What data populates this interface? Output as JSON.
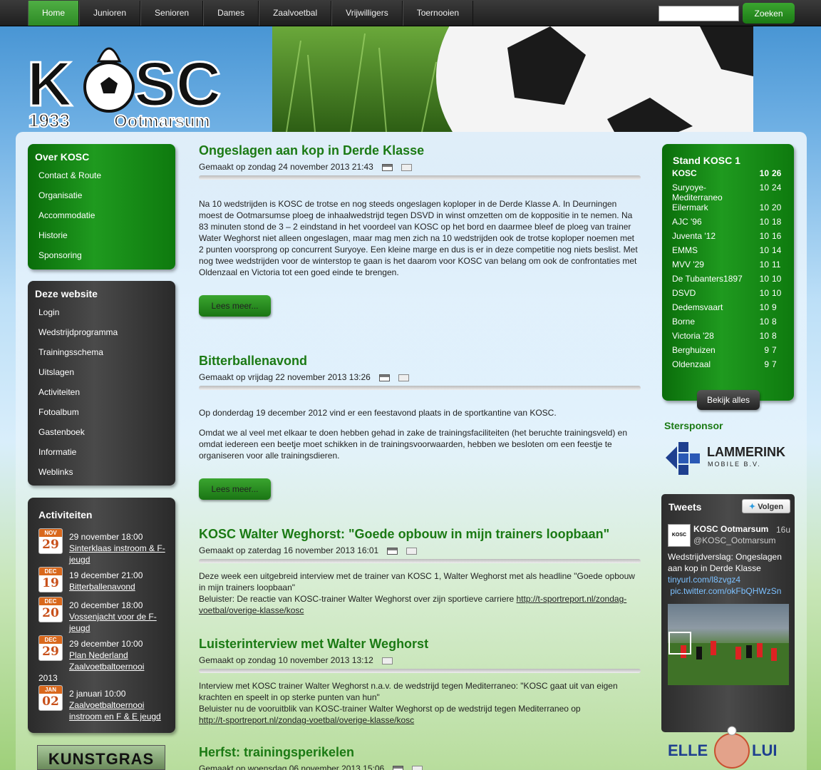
{
  "nav": {
    "items": [
      "Home",
      "Junioren",
      "Senioren",
      "Dames",
      "Zaalvoetbal",
      "Vrijwilligers",
      "Toernooien"
    ],
    "search_button": "Zoeken"
  },
  "logo": {
    "name": "KOSC",
    "year": "1933",
    "town": "Ootmarsum"
  },
  "over": {
    "title": "Over KOSC",
    "items": [
      "Contact & Route",
      "Organisatie",
      "Accommodatie",
      "Historie",
      "Sponsoring"
    ]
  },
  "site": {
    "title": "Deze website",
    "items": [
      "Login",
      "Wedstrijdprogramma",
      "Trainingsschema",
      "Uitslagen",
      "Activiteiten",
      "Fotoalbum",
      "Gastenboek",
      "Informatie",
      "Weblinks"
    ]
  },
  "activiteiten": {
    "title": "Activiteiten",
    "items": [
      {
        "month": "NOV",
        "day": "29",
        "when": "29 november 18:00",
        "what": "Sinterklaas instroom & F-jeugd"
      },
      {
        "month": "DEC",
        "day": "19",
        "when": "19 december 21:00",
        "what": "Bitterballenavond"
      },
      {
        "month": "DEC",
        "day": "20",
        "when": "20 december 18:00",
        "what": "Vossenjacht voor de F-jeugd"
      },
      {
        "month": "DEC",
        "day": "29",
        "when": "29 december 10:00",
        "what": "Plan Nederland Zaalvoetbaltoernooi",
        "extra": "2013"
      },
      {
        "month": "JAN",
        "day": "02",
        "when": "2 januari 10:00",
        "what": "Zaalvoetbaltoernooi instroom en F & E jeugd"
      }
    ]
  },
  "kunstgras": "KUNSTGRAS",
  "articles": [
    {
      "title": "Ongeslagen aan kop in Derde Klasse",
      "meta": "Gemaakt op zondag 24 november 2013 21:43",
      "body": [
        "Na 10 wedstrijden is KOSC de trotse en nog steeds ongeslagen koploper in de Derde Klasse A. In Deurningen moest de Ootmarsumse ploeg de inhaalwedstrijd tegen DSVD in winst omzetten om de koppositie in te nemen. Na 83 minuten stond de 3 – 2 eindstand in het voordeel van KOSC op het bord en daarmee bleef de ploeg van trainer Water Weghorst niet alleen ongeslagen, maar mag men zich na 10 wedstrijden ook de trotse koploper noemen met 2 punten voorsprong op concurrent Suryoye. Een kleine marge en dus is er in deze competitie nog niets beslist. Met nog twee wedstrijden voor de winterstop te gaan is het daarom voor KOSC van belang om ook de confrontaties met Oldenzaal en Victoria tot een goed einde te brengen."
      ],
      "readmore": "Lees meer..."
    },
    {
      "title": "Bitterballenavond",
      "meta": "Gemaakt op vrijdag 22 november 2013 13:26",
      "body": [
        "Op donderdag 19 december 2012 vind er een feestavond plaats in de sportkantine van KOSC.",
        "Omdat we al veel met elkaar te doen hebben gehad in zake de trainingsfaciliteiten (het beruchte trainingsveld) en omdat iedereen een beetje moet schikken in de trainingsvoorwaarden, hebben we besloten om een feestje te organiseren voor alle trainingsdieren."
      ],
      "readmore": "Lees meer..."
    },
    {
      "title": "KOSC Walter Weghorst: \"Goede opbouw in mijn trainers loopbaan\"",
      "meta": "Gemaakt op zaterdag 16 november 2013 16:01",
      "body": [
        "Deze week een uitgebreid interview met de trainer van KOSC 1, Walter Weghorst met als headline  \"Goede opbouw in mijn trainers loopbaan\"",
        "Beluister: De reactie van KOSC-trainer Walter Weghorst over zijn sportieve carriere "
      ],
      "link": "http://t-sportreport.nl/zondag-voetbal/overige-klasse/kosc"
    },
    {
      "title": "Luisterinterview met Walter Weghorst",
      "meta": "Gemaakt op zondag 10 november 2013 13:12",
      "body": [
        "Interview met KOSC trainer Walter Weghorst n.a.v. de wedstrijd tegen Mediterraneo: \"KOSC gaat uit van eigen krachten en speelt in op sterke punten van hun\"",
        "Beluister nu de vooruitblik van KOSC-trainer Walter Weghorst op de wedstrijd tegen Mediterraneo op"
      ],
      "link": "http://t-sportreport.nl/zondag-voetbal/overige-klasse/kosc"
    },
    {
      "title": "Herfst: trainingsperikelen",
      "meta": "Gemaakt op woensdag 06 november 2013 15:06"
    }
  ],
  "stand": {
    "title": "Stand KOSC 1",
    "rows": [
      [
        "KOSC",
        "10",
        "26"
      ],
      [
        "Suryoye-Mediterraneo",
        "10",
        "24"
      ],
      [
        "Eilermark",
        "10",
        "20"
      ],
      [
        "AJC '96",
        "10",
        "18"
      ],
      [
        "Juventa '12",
        "10",
        "16"
      ],
      [
        "EMMS",
        "10",
        "14"
      ],
      [
        "MVV '29",
        "10",
        "11"
      ],
      [
        "De Tubanters1897",
        "10",
        "10"
      ],
      [
        "DSVD",
        "10",
        "10"
      ],
      [
        "Dedemsvaart",
        "10",
        "9"
      ],
      [
        "Borne",
        "10",
        "8"
      ],
      [
        "Victoria '28",
        "10",
        "8"
      ],
      [
        "Berghuizen",
        "9",
        "7"
      ],
      [
        "Oldenzaal",
        "9",
        "7"
      ]
    ],
    "button": "Bekijk alles"
  },
  "stersponsor": {
    "label": "Stersponsor",
    "name": "LAMMERINK",
    "sub": "MOBILE B.V."
  },
  "tweets": {
    "title": "Tweets",
    "follow": "Volgen",
    "avatar": "KOSC",
    "name": "KOSC Ootmarsum",
    "handle": "@KOSC_Ootmarsum",
    "time": "16u",
    "text": "Wedstrijdverslag: Ongeslagen aan kop in Derde Klasse ",
    "link1": "tinyurl.com/l8zvgz4",
    "link2": "pic.twitter.com/okFbQHWzSn"
  },
  "elle": {
    "left": "ELLE",
    "right": "LUI"
  }
}
